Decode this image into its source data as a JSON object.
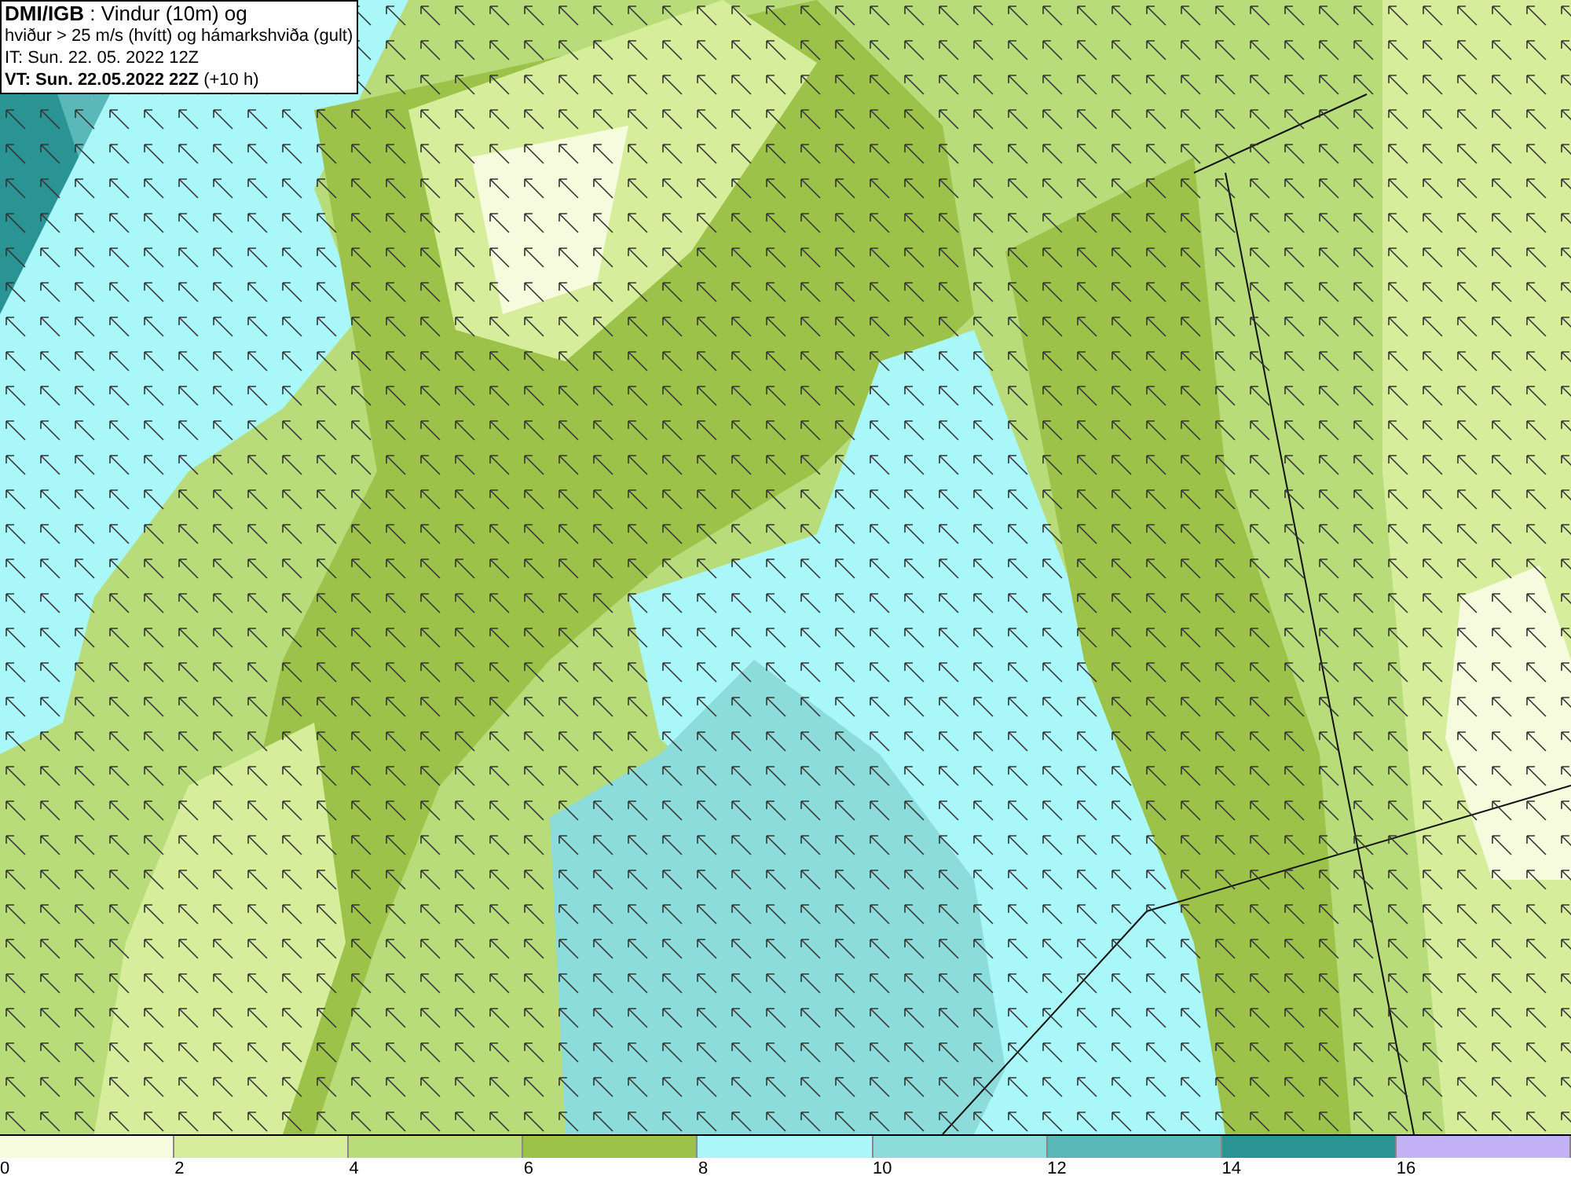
{
  "header": {
    "lines": [
      "**DMI/IGB** : Vindur (10m) og",
      "hviður > 25 m/s (hvítt) og hámarkshviða (gult)",
      "IT: Sun. 22. 05. 2022 12Z",
      "**VT: Sun. 22.05.2022 22Z** (+10 h)"
    ]
  },
  "legend": {
    "bins": [
      {
        "label": "0",
        "color": "#f5fbdc"
      },
      {
        "label": "2",
        "color": "#d6ee9c"
      },
      {
        "label": "4",
        "color": "#b8dc7a"
      },
      {
        "label": "6",
        "color": "#9cc24a"
      },
      {
        "label": "8",
        "color": "#aaf7f9"
      },
      {
        "label": "10",
        "color": "#8ddcdc"
      },
      {
        "label": "12",
        "color": "#5ab8b8"
      },
      {
        "label": "14",
        "color": "#2a9494"
      },
      {
        "label": "16",
        "color": "#c2b1f5"
      }
    ]
  }
}
